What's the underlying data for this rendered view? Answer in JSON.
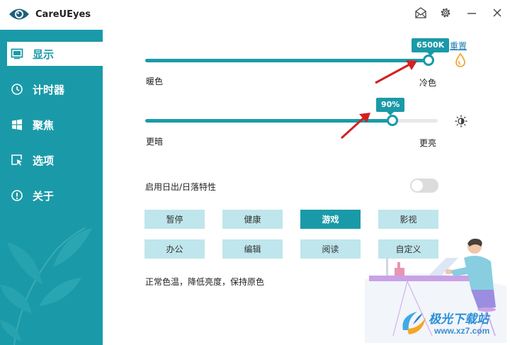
{
  "app": {
    "title": "CareUEyes"
  },
  "sidebar": {
    "items": [
      {
        "label": "显示",
        "icon": "monitor-icon",
        "active": true
      },
      {
        "label": "计时器",
        "icon": "clock-icon",
        "active": false
      },
      {
        "label": "聚焦",
        "icon": "windows-icon",
        "active": false
      },
      {
        "label": "选项",
        "icon": "cursor-select-icon",
        "active": false
      },
      {
        "label": "关于",
        "icon": "info-icon",
        "active": false
      }
    ]
  },
  "color_temp": {
    "value_label": "6500K",
    "reset_label": "重置",
    "warm_label": "暖色",
    "cool_label": "冷色",
    "level": 1.0
  },
  "brightness": {
    "value_label": "90%",
    "dim_label": "更暗",
    "bright_label": "更亮",
    "level": 0.9
  },
  "sunrise": {
    "label": "启用日出/日落特性",
    "enabled": false
  },
  "modes": {
    "row1": [
      "暂停",
      "健康",
      "游戏",
      "影视"
    ],
    "row2": [
      "办公",
      "编辑",
      "阅读",
      "自定义"
    ],
    "active": "游戏"
  },
  "description": "正常色温，降低亮度，保持原色",
  "watermark": {
    "title": "极光下载站",
    "url": "www.xz7.com"
  },
  "colors": {
    "accent": "#1a9aa8",
    "button_bg": "#bfe6ec",
    "arrow": "#d42020"
  }
}
